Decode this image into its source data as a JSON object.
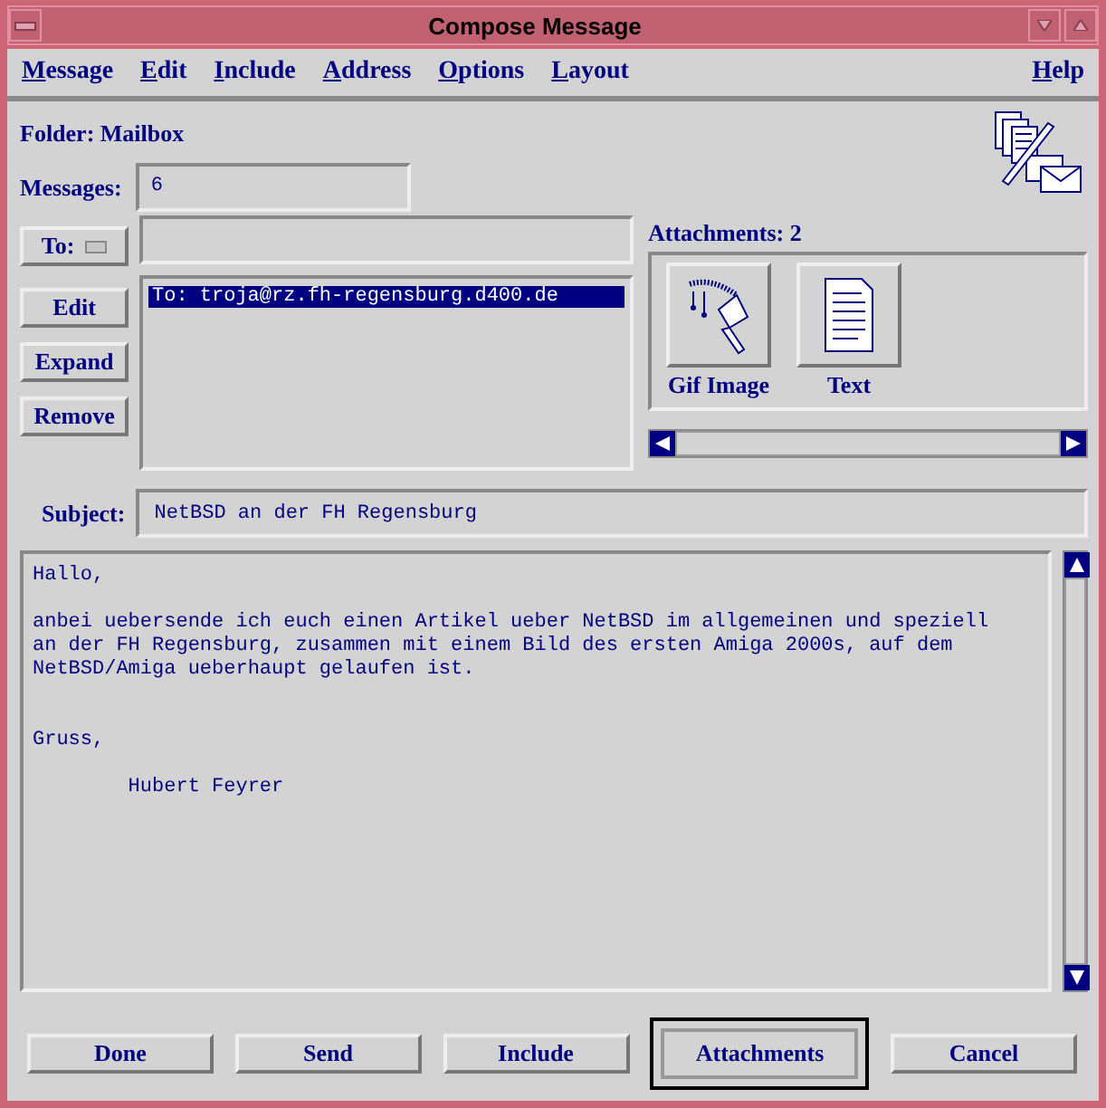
{
  "window": {
    "title": "Compose Message"
  },
  "menu": {
    "items": [
      "Message",
      "Edit",
      "Include",
      "Address",
      "Options",
      "Layout"
    ],
    "help": "Help"
  },
  "folder": {
    "label": "Folder: Mailbox"
  },
  "messages": {
    "label": "Messages:",
    "value": "6"
  },
  "to_button": "To:",
  "address_buttons": [
    "Edit",
    "Expand",
    "Remove"
  ],
  "recipients": [
    {
      "text": "To: troja@rz.fh-regensburg.d400.de",
      "selected": true
    }
  ],
  "attachments": {
    "label": "Attachments: 2",
    "items": [
      {
        "kind": "image",
        "label": "Gif Image"
      },
      {
        "kind": "text",
        "label": "Text"
      }
    ]
  },
  "subject": {
    "label": "Subject:",
    "value": "NetBSD an der FH Regensburg"
  },
  "body": "Hallo,\n\nanbei uebersende ich euch einen Artikel ueber NetBSD im allgemeinen und speziell\nan der FH Regensburg, zusammen mit einem Bild des ersten Amiga 2000s, auf dem\nNetBSD/Amiga ueberhaupt gelaufen ist.\n\n\nGruss,\n\n        Hubert Feyrer",
  "buttons": [
    {
      "label": "Done",
      "selected": false
    },
    {
      "label": "Send",
      "selected": false
    },
    {
      "label": "Include",
      "selected": false
    },
    {
      "label": "Attachments",
      "selected": true
    },
    {
      "label": "Cancel",
      "selected": false
    }
  ]
}
